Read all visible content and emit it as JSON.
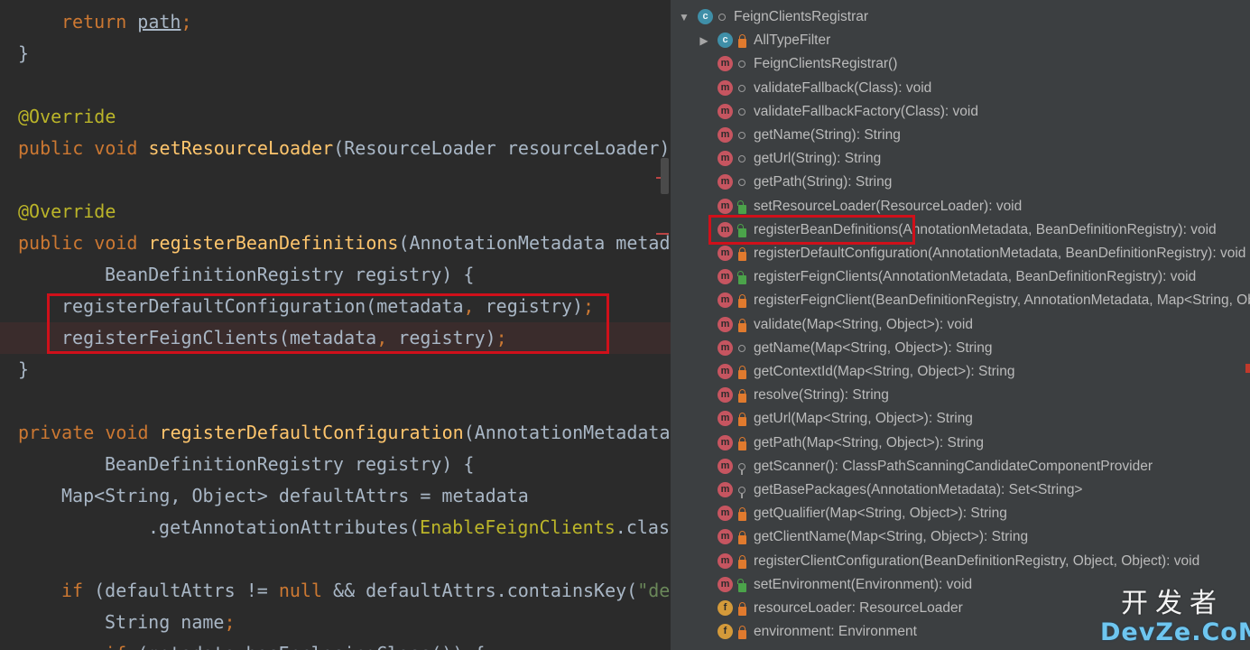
{
  "editor": {
    "lines": [
      {
        "indent": 1,
        "parts": [
          {
            "t": "return ",
            "c": "kw"
          },
          {
            "t": "path",
            "c": "u"
          },
          {
            "t": ";",
            "c": "kw"
          }
        ]
      },
      {
        "indent": 0,
        "parts": [
          {
            "t": "}",
            "c": ""
          }
        ]
      },
      {
        "indent": 0,
        "parts": []
      },
      {
        "indent": 0,
        "parts": [
          {
            "t": "@Override",
            "c": "ann"
          }
        ]
      },
      {
        "indent": 0,
        "parts": [
          {
            "t": "public void ",
            "c": "kw"
          },
          {
            "t": "setResourceLoader",
            "c": "fn"
          },
          {
            "t": "(ResourceLoader resourceLoader) {",
            "c": ""
          }
        ]
      },
      {
        "indent": 0,
        "parts": []
      },
      {
        "indent": 0,
        "parts": [
          {
            "t": "@Override",
            "c": "ann"
          }
        ]
      },
      {
        "indent": 0,
        "parts": [
          {
            "t": "public void ",
            "c": "kw"
          },
          {
            "t": "registerBeanDefinitions",
            "c": "fn"
          },
          {
            "t": "(AnnotationMetadata metadata,",
            "c": ""
          }
        ]
      },
      {
        "indent": 2,
        "parts": [
          {
            "t": "BeanDefinitionRegistry registry) {",
            "c": ""
          }
        ]
      },
      {
        "indent": 1,
        "parts": [
          {
            "t": "registerDefaultConfiguration(metadata",
            "c": ""
          },
          {
            "t": ", ",
            "c": "kw"
          },
          {
            "t": "registry)",
            "c": ""
          },
          {
            "t": ";",
            "c": "kw"
          }
        ]
      },
      {
        "indent": 1,
        "parts": [
          {
            "t": "registerFeignClients(metadata",
            "c": ""
          },
          {
            "t": ", ",
            "c": "kw"
          },
          {
            "t": "registry)",
            "c": ""
          },
          {
            "t": ";",
            "c": "kw"
          }
        ]
      },
      {
        "indent": 0,
        "parts": [
          {
            "t": "}",
            "c": ""
          }
        ]
      },
      {
        "indent": 0,
        "parts": []
      },
      {
        "indent": 0,
        "parts": [
          {
            "t": "private void ",
            "c": "kw"
          },
          {
            "t": "registerDefaultConfiguration",
            "c": "fn"
          },
          {
            "t": "(AnnotationMetadata metadata,",
            "c": ""
          }
        ]
      },
      {
        "indent": 2,
        "parts": [
          {
            "t": "BeanDefinitionRegistry registry) {",
            "c": ""
          }
        ]
      },
      {
        "indent": 1,
        "parts": [
          {
            "t": "Map<String, Object> defaultAttrs = metadata",
            "c": ""
          }
        ]
      },
      {
        "indent": 3,
        "parts": [
          {
            "t": ".getAnnotationAttributes(",
            "c": ""
          },
          {
            "t": "EnableFeignClients",
            "c": "ann"
          },
          {
            "t": ".class.getName()",
            "c": ""
          }
        ]
      },
      {
        "indent": 0,
        "parts": []
      },
      {
        "indent": 1,
        "parts": [
          {
            "t": "if ",
            "c": "kw"
          },
          {
            "t": "(defaultAttrs != ",
            "c": ""
          },
          {
            "t": "null ",
            "c": "kw"
          },
          {
            "t": "&& defaultAttrs.containsKey(",
            "c": ""
          },
          {
            "t": "\"defaultConfiguration\"",
            "c": "str"
          },
          {
            "t": ")) {",
            "c": ""
          }
        ]
      },
      {
        "indent": 2,
        "parts": [
          {
            "t": "String name",
            "c": ""
          },
          {
            "t": ";",
            "c": "kw"
          }
        ]
      },
      {
        "indent": 2,
        "parts": [
          {
            "t": "if ",
            "c": "kw"
          },
          {
            "t": "(metadata.hasEnclosingClass()) {",
            "c": ""
          }
        ]
      }
    ]
  },
  "structure": {
    "items": [
      {
        "depth": 0,
        "arrow": "down",
        "icon": "c",
        "mod": "dot",
        "label": "FeignClientsRegistrar"
      },
      {
        "depth": 1,
        "arrow": "right",
        "icon": "c",
        "mod": "lock",
        "label": "AllTypeFilter"
      },
      {
        "depth": 1,
        "arrow": "",
        "icon": "m",
        "mod": "dot",
        "label": "FeignClientsRegistrar()"
      },
      {
        "depth": 1,
        "arrow": "",
        "icon": "m",
        "mod": "dot",
        "label": "validateFallback(Class): void"
      },
      {
        "depth": 1,
        "arrow": "",
        "icon": "m",
        "mod": "dot",
        "label": "validateFallbackFactory(Class): void"
      },
      {
        "depth": 1,
        "arrow": "",
        "icon": "m",
        "mod": "dot",
        "label": "getName(String): String"
      },
      {
        "depth": 1,
        "arrow": "",
        "icon": "m",
        "mod": "dot",
        "label": "getUrl(String): String"
      },
      {
        "depth": 1,
        "arrow": "",
        "icon": "m",
        "mod": "dot",
        "label": "getPath(String): String"
      },
      {
        "depth": 1,
        "arrow": "",
        "icon": "m",
        "mod": "pub",
        "label": "setResourceLoader(ResourceLoader): void"
      },
      {
        "depth": 1,
        "arrow": "",
        "icon": "m",
        "mod": "pub",
        "label": "registerBeanDefinitions(AnnotationMetadata, BeanDefinitionRegistry): void"
      },
      {
        "depth": 1,
        "arrow": "",
        "icon": "m",
        "mod": "lock",
        "label": "registerDefaultConfiguration(AnnotationMetadata, BeanDefinitionRegistry): void"
      },
      {
        "depth": 1,
        "arrow": "",
        "icon": "m",
        "mod": "pub",
        "label": "registerFeignClients(AnnotationMetadata, BeanDefinitionRegistry): void"
      },
      {
        "depth": 1,
        "arrow": "",
        "icon": "m",
        "mod": "lock",
        "label": "registerFeignClient(BeanDefinitionRegistry, AnnotationMetadata, Map<String, Object>): void"
      },
      {
        "depth": 1,
        "arrow": "",
        "icon": "m",
        "mod": "lock",
        "label": "validate(Map<String, Object>): void"
      },
      {
        "depth": 1,
        "arrow": "",
        "icon": "m",
        "mod": "dot",
        "label": "getName(Map<String, Object>): String"
      },
      {
        "depth": 1,
        "arrow": "",
        "icon": "m",
        "mod": "lock",
        "label": "getContextId(Map<String, Object>): String"
      },
      {
        "depth": 1,
        "arrow": "",
        "icon": "m",
        "mod": "lock",
        "label": "resolve(String): String"
      },
      {
        "depth": 1,
        "arrow": "",
        "icon": "m",
        "mod": "lock",
        "label": "getUrl(Map<String, Object>): String"
      },
      {
        "depth": 1,
        "arrow": "",
        "icon": "m",
        "mod": "lock",
        "label": "getPath(Map<String, Object>): String"
      },
      {
        "depth": 1,
        "arrow": "",
        "icon": "m",
        "mod": "pkg",
        "label": "getScanner(): ClassPathScanningCandidateComponentProvider"
      },
      {
        "depth": 1,
        "arrow": "",
        "icon": "m",
        "mod": "pkg",
        "label": "getBasePackages(AnnotationMetadata): Set<String>"
      },
      {
        "depth": 1,
        "arrow": "",
        "icon": "m",
        "mod": "lock",
        "label": "getQualifier(Map<String, Object>): String"
      },
      {
        "depth": 1,
        "arrow": "",
        "icon": "m",
        "mod": "lock",
        "label": "getClientName(Map<String, Object>): String"
      },
      {
        "depth": 1,
        "arrow": "",
        "icon": "m",
        "mod": "lock",
        "label": "registerClientConfiguration(BeanDefinitionRegistry, Object, Object): void"
      },
      {
        "depth": 1,
        "arrow": "",
        "icon": "m",
        "mod": "pub",
        "label": "setEnvironment(Environment): void"
      },
      {
        "depth": 1,
        "arrow": "",
        "icon": "f",
        "mod": "lock",
        "label": "resourceLoader: ResourceLoader"
      },
      {
        "depth": 1,
        "arrow": "",
        "icon": "f",
        "mod": "lock",
        "label": "environment: Environment"
      }
    ]
  },
  "watermark": {
    "cn": "开发者",
    "en": "DevZe.CoM"
  },
  "colors": {
    "highlight_box": "#d0101a",
    "keyword": "#cc7832",
    "annotation": "#bbb529",
    "method": "#ffc66d"
  }
}
